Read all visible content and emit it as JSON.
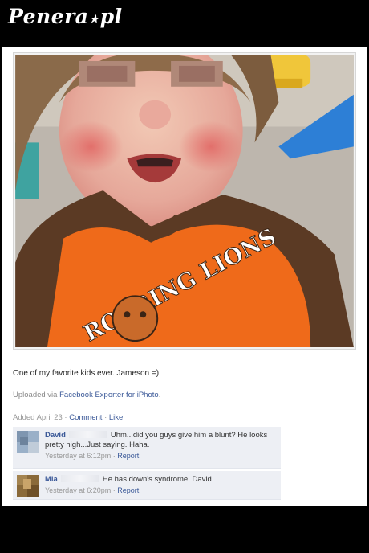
{
  "header": {
    "logo_main": "Penera",
    "logo_dot": "★",
    "logo_tld": "pl"
  },
  "post": {
    "caption": "One of my favorite kids ever. Jameson =)",
    "uploaded_prefix": "Uploaded via ",
    "uploaded_app": "Facebook Exporter for iPhoto",
    "uploaded_suffix": ".",
    "added": "Added April 23",
    "sep": " · ",
    "comment_link": "Comment",
    "like_link": "Like",
    "shirt_text": "ROARING LIONS"
  },
  "comments": [
    {
      "name": "David",
      "text": "Uhm...did you guys give him a blunt? He looks pretty high...Just saying. Haha.",
      "time": "Yesterday at 6:12pm",
      "report": "Report"
    },
    {
      "name": "Mia",
      "text": "He has down's syndrome, David.",
      "time": "Yesterday at 6:20pm",
      "report": "Report"
    }
  ],
  "colors": {
    "link": "#3b5998",
    "comment_bg": "#edeff4",
    "frame": "#000000"
  }
}
